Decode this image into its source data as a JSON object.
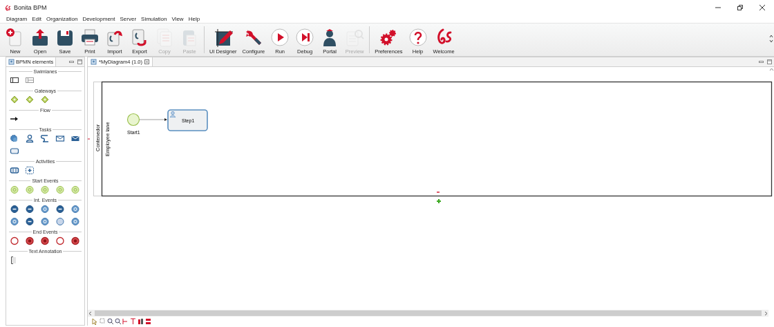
{
  "window": {
    "title": "Bonita BPM"
  },
  "menu": [
    "Diagram",
    "Edit",
    "Organization",
    "Development",
    "Server",
    "Simulation",
    "View",
    "Help"
  ],
  "toolbar": [
    [
      {
        "label": "New",
        "kind": "new",
        "disabled": false
      },
      {
        "label": "Open",
        "kind": "open",
        "disabled": false
      },
      {
        "label": "Save",
        "kind": "save",
        "disabled": false
      },
      {
        "label": "Print",
        "kind": "print",
        "disabled": false
      },
      {
        "label": "Import",
        "kind": "import",
        "disabled": false
      },
      {
        "label": "Export",
        "kind": "export",
        "disabled": false
      },
      {
        "label": "Copy",
        "kind": "copy",
        "disabled": true
      },
      {
        "label": "Paste",
        "kind": "paste",
        "disabled": true
      }
    ],
    [
      {
        "label": "UI Designer",
        "kind": "ui-designer",
        "disabled": false
      },
      {
        "label": "Configure",
        "kind": "configure",
        "disabled": false
      },
      {
        "label": "Run",
        "kind": "run",
        "disabled": false
      },
      {
        "label": "Debug",
        "kind": "debug",
        "disabled": false
      },
      {
        "label": "Portal",
        "kind": "portal",
        "disabled": false
      },
      {
        "label": "Preview",
        "kind": "preview",
        "disabled": true
      }
    ],
    [
      {
        "label": "Preferences",
        "kind": "preferences",
        "disabled": false
      },
      {
        "label": "Help",
        "kind": "help",
        "disabled": false
      },
      {
        "label": "Welcome",
        "kind": "welcome",
        "disabled": false
      }
    ]
  ],
  "palette": {
    "title": "BPMN elements",
    "sections": [
      {
        "title": "Swimlanes",
        "items": [
          {
            "kind": "pool"
          },
          {
            "kind": "lane"
          }
        ]
      },
      {
        "title": "Gateways",
        "items": [
          {
            "kind": "gateway"
          },
          {
            "kind": "gateway"
          },
          {
            "kind": "gateway"
          }
        ]
      },
      {
        "title": "Flow",
        "items": [
          {
            "kind": "flow"
          }
        ]
      },
      {
        "title": "Tasks",
        "items": [
          {
            "kind": "service-task"
          },
          {
            "kind": "human-task"
          },
          {
            "kind": "script-task"
          },
          {
            "kind": "receive-task"
          },
          {
            "kind": "send-task"
          },
          {
            "kind": "task"
          }
        ]
      },
      {
        "title": "Activities",
        "items": [
          {
            "kind": "call-activity"
          },
          {
            "kind": "subprocess"
          }
        ]
      },
      {
        "title": "Start Events",
        "items": [
          {
            "kind": "start-event"
          },
          {
            "kind": "start-event"
          },
          {
            "kind": "start-event"
          },
          {
            "kind": "start-event"
          },
          {
            "kind": "start-event"
          }
        ]
      },
      {
        "title": "Int. Events",
        "items": [
          {
            "kind": "int-event-dark"
          },
          {
            "kind": "int-event-dark"
          },
          {
            "kind": "int-event"
          },
          {
            "kind": "int-event-dark"
          },
          {
            "kind": "int-event"
          },
          {
            "kind": "int-event"
          },
          {
            "kind": "int-event-dark"
          },
          {
            "kind": "int-event"
          },
          {
            "kind": "int-event-light"
          },
          {
            "kind": "int-event"
          }
        ]
      },
      {
        "title": "End Events",
        "items": [
          {
            "kind": "end-event"
          },
          {
            "kind": "end-event-dark"
          },
          {
            "kind": "end-event-dark"
          },
          {
            "kind": "end-event"
          },
          {
            "kind": "end-event-dark"
          }
        ]
      },
      {
        "title": "Text Annotation",
        "items": [
          {
            "kind": "annotation"
          }
        ]
      }
    ]
  },
  "editor": {
    "tab": "*MyDiagram4 (1.0)",
    "pool": "Contenedor",
    "lane": "Employee lane",
    "start_event": "Start1",
    "task": "Step1"
  }
}
